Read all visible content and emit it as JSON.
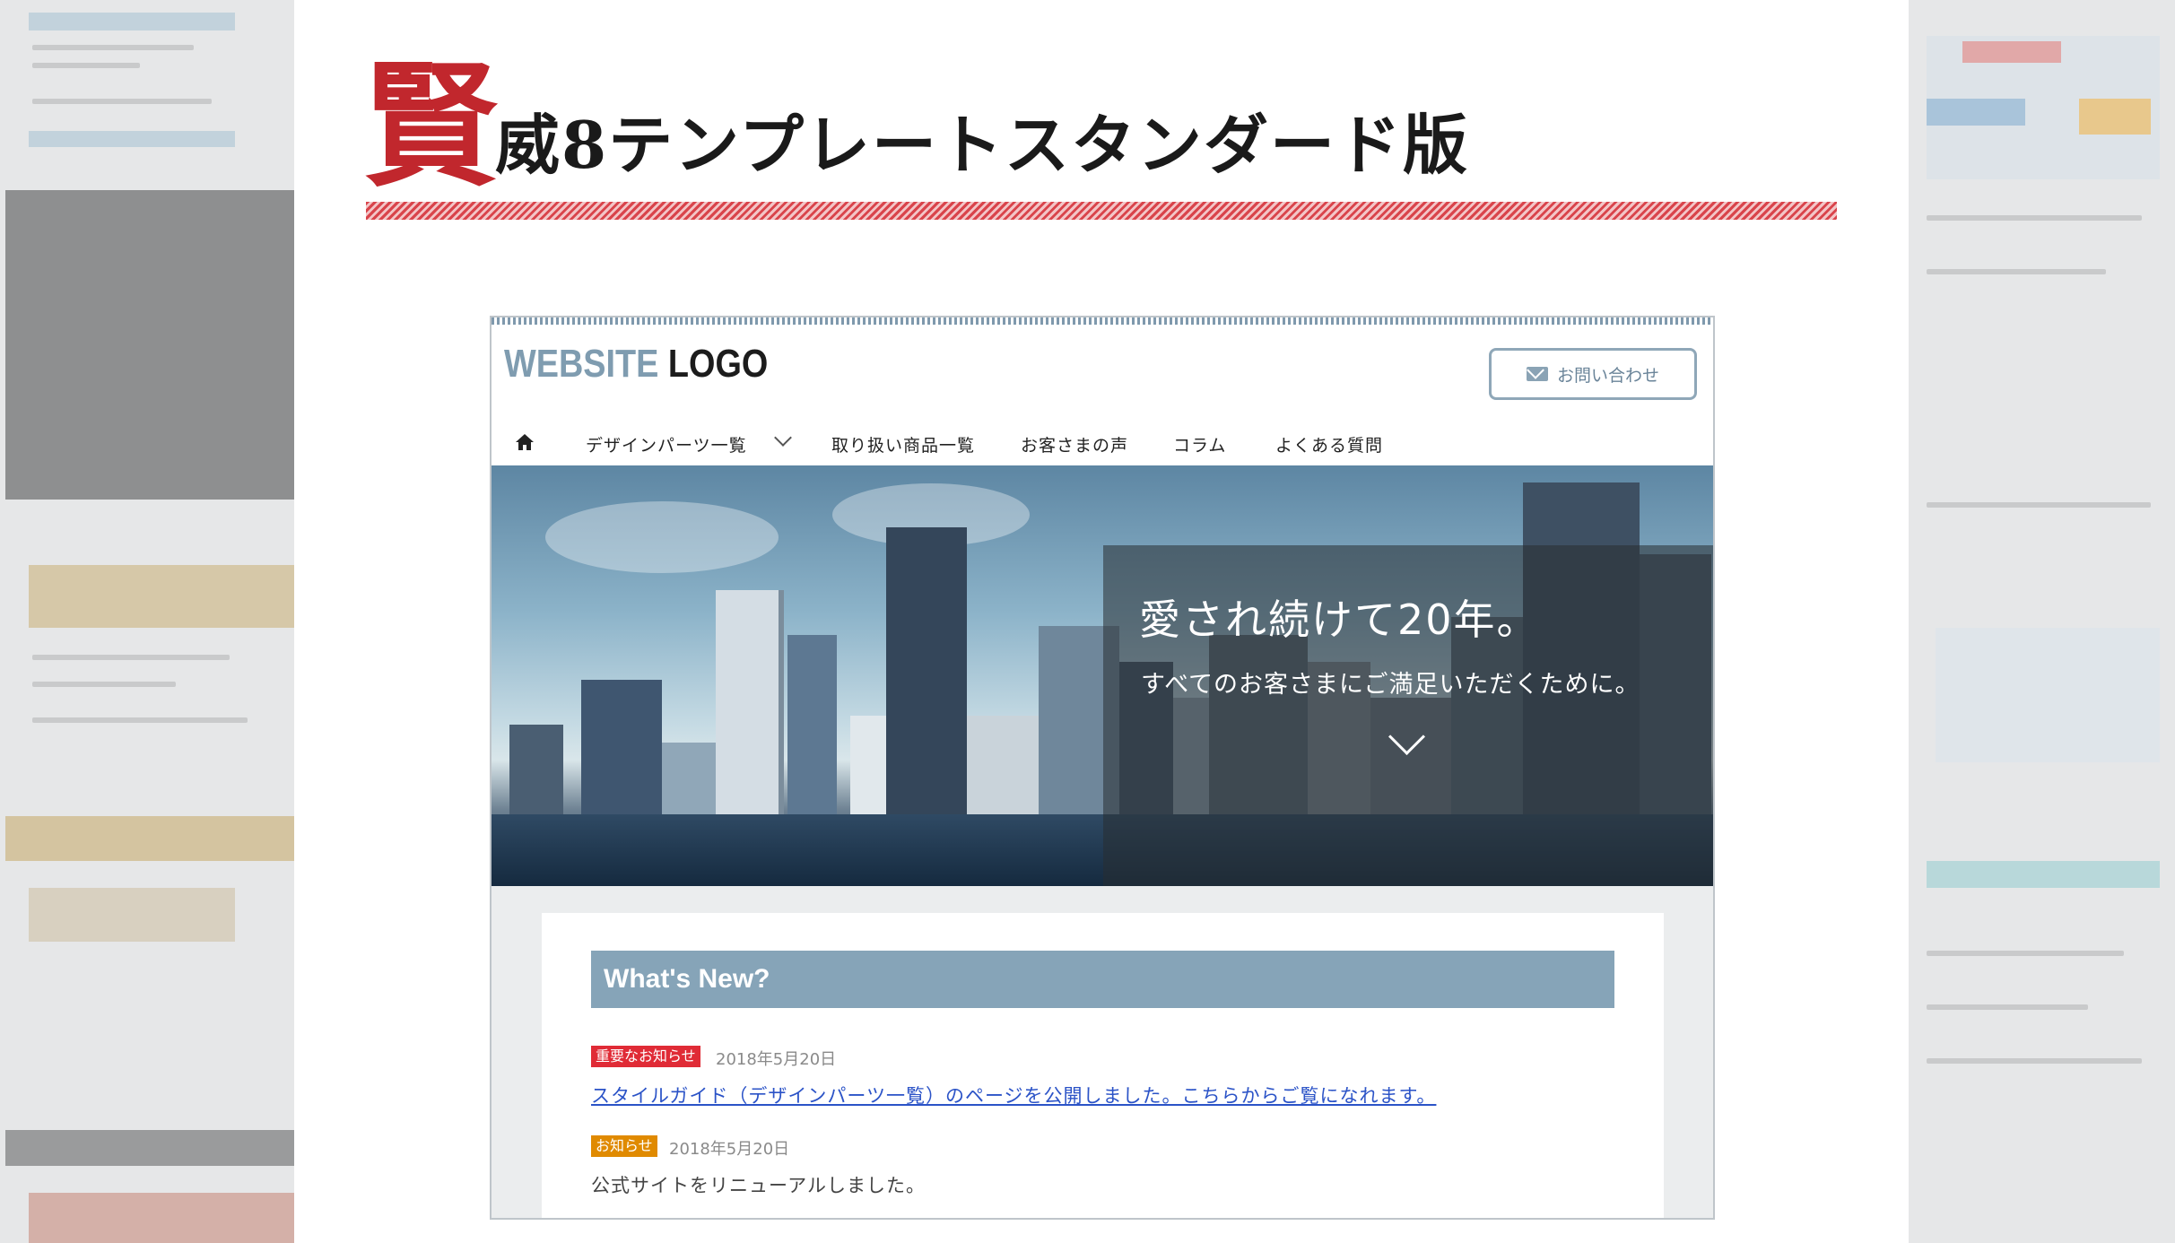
{
  "slide": {
    "title_kanji": "賢",
    "title_rest": "威8テンプレートスタンダード版"
  },
  "website": {
    "logo_part1": "WEBSITE",
    "logo_part2": "LOGO",
    "contact_button": "お問い合わせ",
    "nav": {
      "items": [
        "デザインパーツ一覧",
        "取り扱い商品一覧",
        "お客さまの声",
        "コラム",
        "よくある質問"
      ]
    },
    "hero": {
      "headline": "愛され続けて20年。",
      "subline": "すべてのお客さまにご満足いただくために。"
    },
    "whats_new": {
      "heading": "What's New?",
      "entries": [
        {
          "badge": "重要なお知らせ",
          "date": "2018年5月20日",
          "text": "スタイルガイド（デザインパーツ一覧）のページを公開しました。こちらからご覧になれます。"
        },
        {
          "badge": "お知らせ",
          "date": "2018年5月20日",
          "text": "公式サイトをリニューアルしました。"
        }
      ]
    }
  },
  "colors": {
    "accent_red": "#c1272d",
    "badge_red": "#e02b36",
    "badge_orange": "#e08a00",
    "whats_new_bg": "#86a4b8",
    "link_blue": "#2b53c7"
  }
}
